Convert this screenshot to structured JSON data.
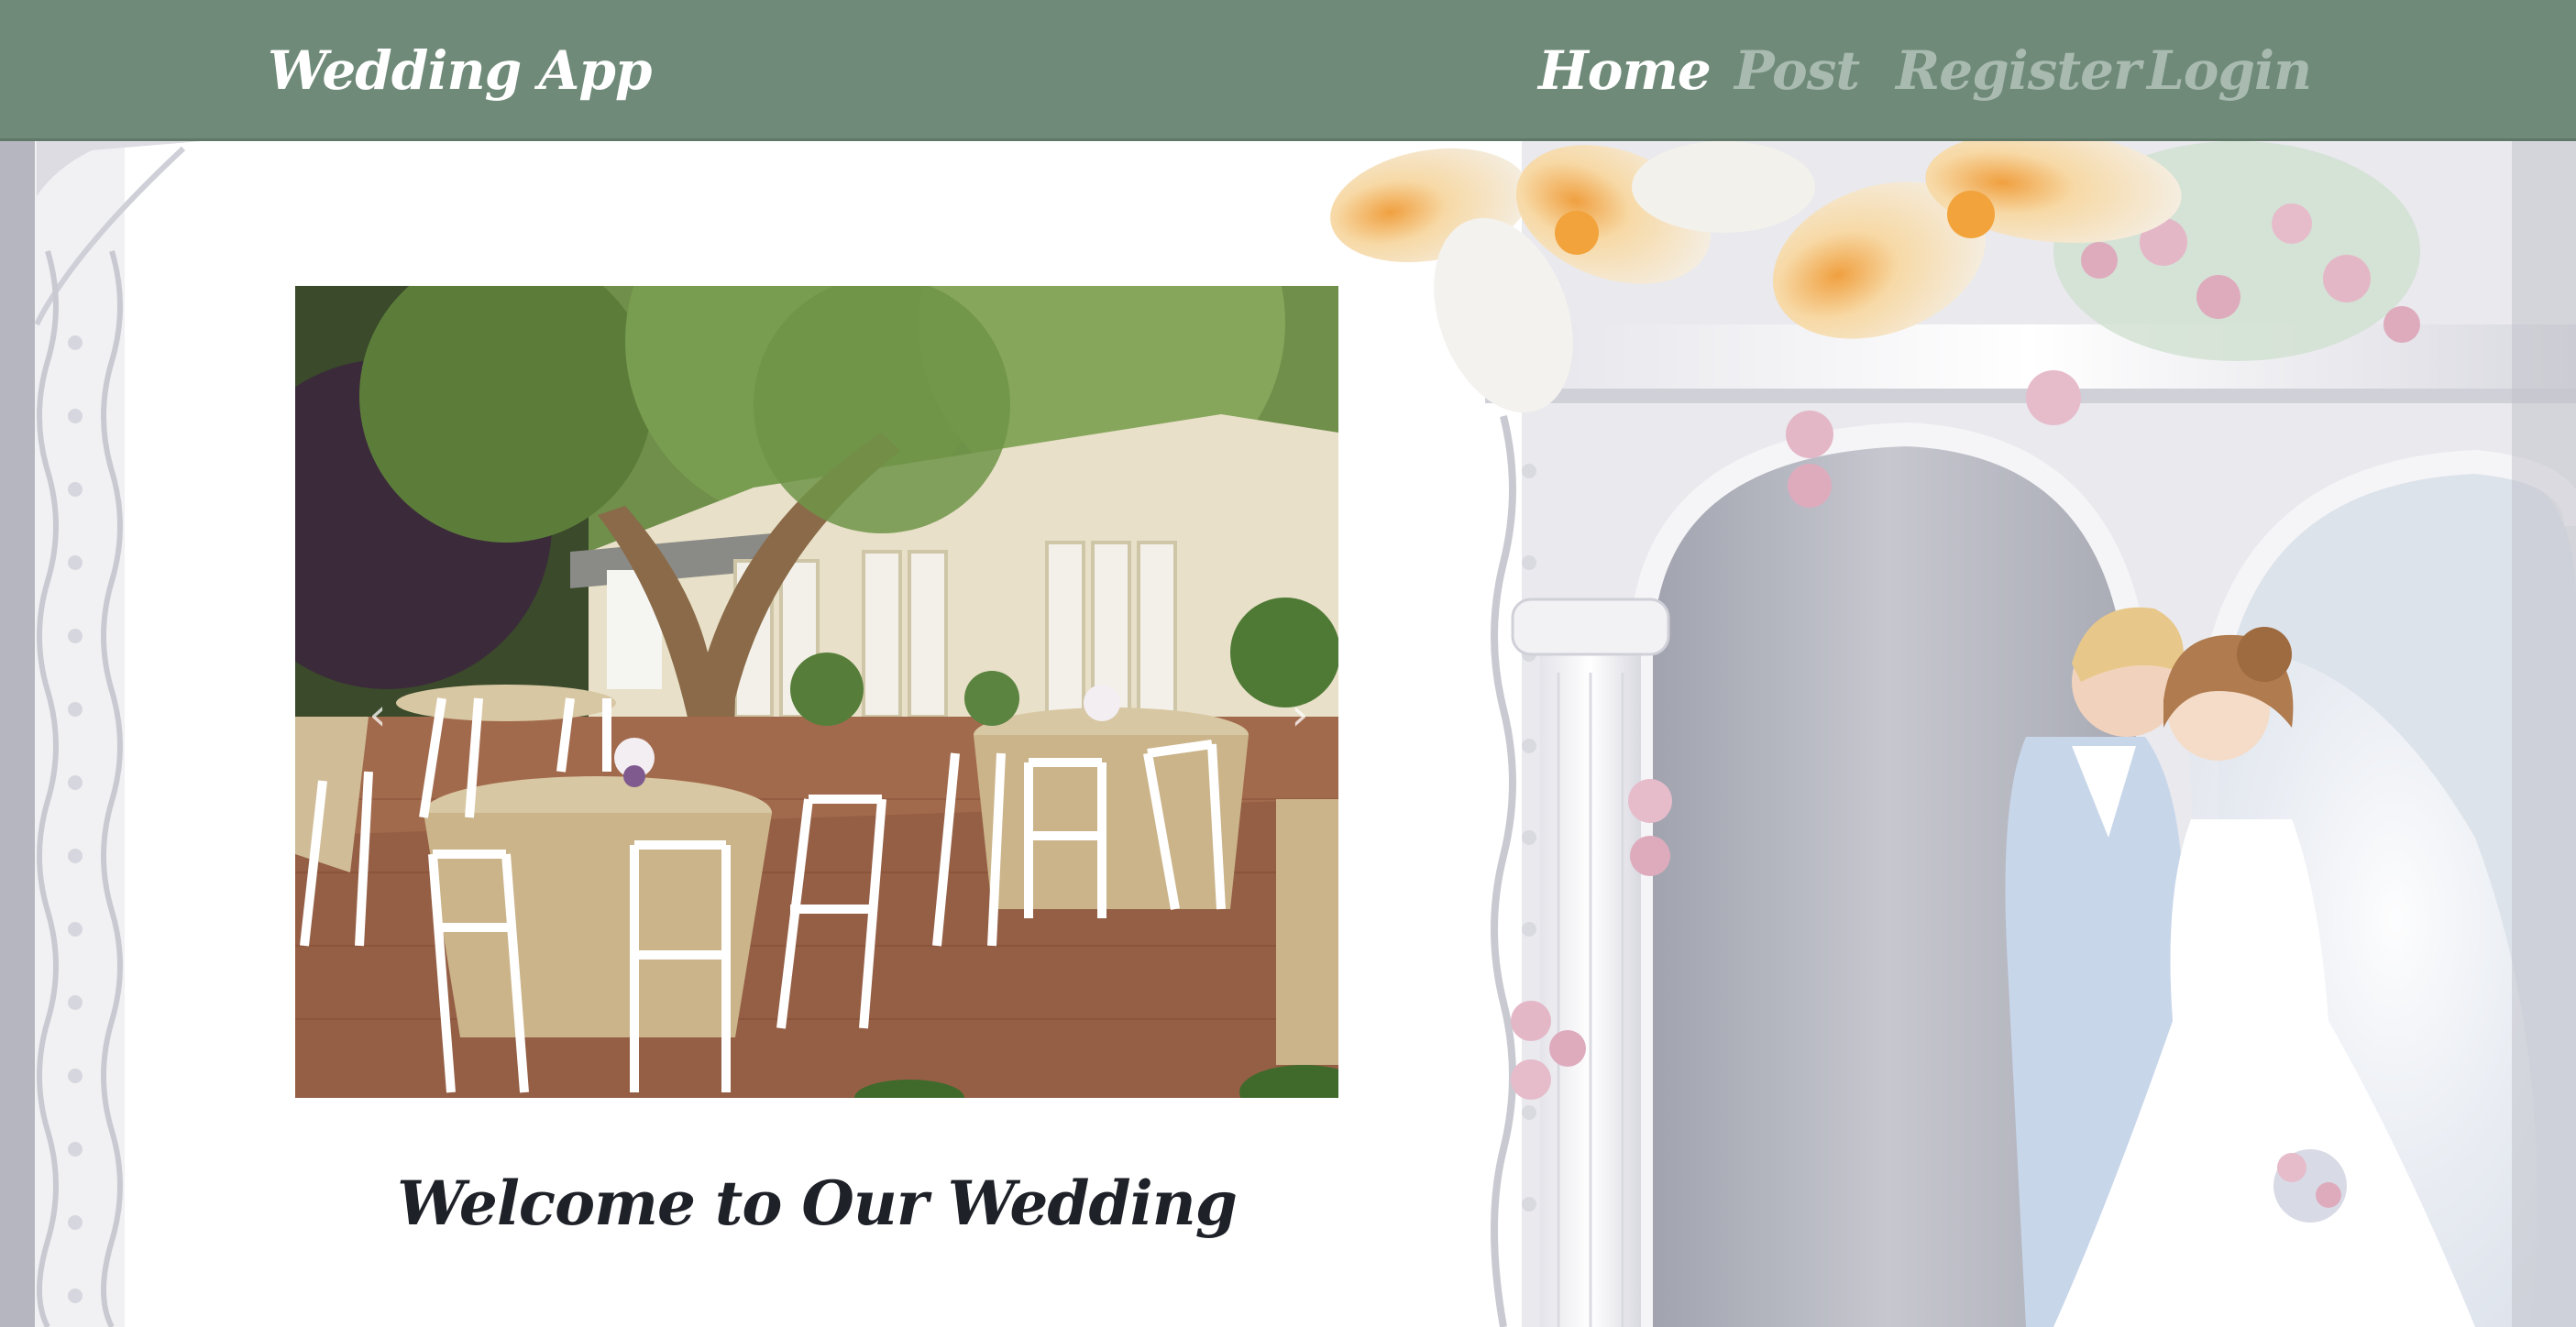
{
  "navbar": {
    "brand": "Wedding App",
    "links": [
      {
        "label": "Home",
        "active": true
      },
      {
        "label": "Post",
        "active": false
      },
      {
        "label": "Register",
        "active": false
      },
      {
        "label": "Login",
        "active": false
      }
    ]
  },
  "carousel": {
    "prev_icon": "chevron-left-icon",
    "next_icon": "chevron-right-icon",
    "prev_glyph": "‹",
    "next_glyph": "›"
  },
  "main": {
    "welcome": "Welcome to Our Wedding"
  },
  "colors": {
    "navbar_bg": "#6f8a78",
    "nav_active": "#ffffff",
    "nav_inactive": "#a9bbb0",
    "heading": "#1e2128"
  }
}
